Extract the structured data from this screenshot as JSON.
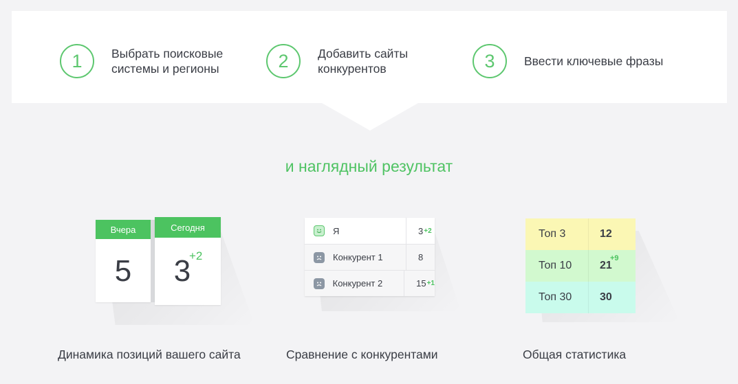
{
  "steps": [
    {
      "number": "1",
      "text": "Выбрать поисковые\nсистемы и регионы"
    },
    {
      "number": "2",
      "text": "Добавить сайты\nконкурентов"
    },
    {
      "number": "3",
      "text": "Ввести ключевые фразы"
    }
  ],
  "result_heading": "и наглядный результат",
  "dynamics": {
    "yesterday_label": "Вчера",
    "yesterday_value": "5",
    "today_label": "Сегодня",
    "today_value": "3",
    "today_delta": "+2",
    "caption": "Динамика позиций вашего сайта"
  },
  "competitors": {
    "rows": [
      {
        "name": "Я",
        "value": "3",
        "delta": "+2",
        "icon": "happy-face-icon"
      },
      {
        "name": "Конкурент 1",
        "value": "8",
        "delta": "",
        "icon": "sad-face-icon"
      },
      {
        "name": "Конкурент 2",
        "value": "15",
        "delta": "+1",
        "icon": "sad-face-icon"
      }
    ],
    "caption": "Сравнение с конкурентами"
  },
  "stats": {
    "rows": [
      {
        "label": "Топ 3",
        "value": "12",
        "delta": "",
        "color": "#fbf7b4"
      },
      {
        "label": "Топ 10",
        "value": "21",
        "delta": "+9",
        "color": "#d2f9cf"
      },
      {
        "label": "Топ 30",
        "value": "30",
        "delta": "",
        "color": "#c9fbec"
      }
    ],
    "caption": "Общая статистика"
  },
  "colors": {
    "accent": "#4cc360",
    "background": "#f3f3f5"
  }
}
